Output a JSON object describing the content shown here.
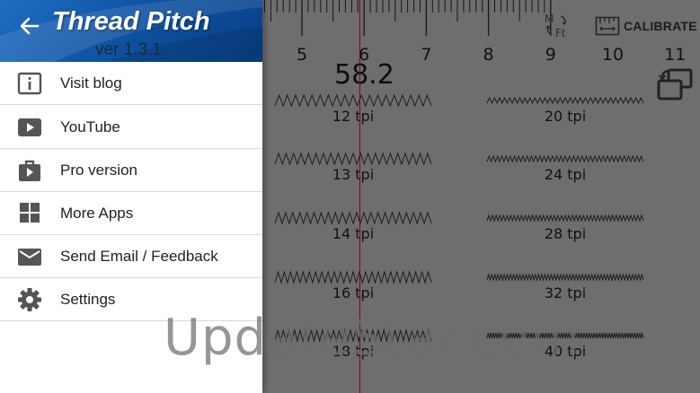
{
  "app": {
    "title": "Thread Pitch",
    "version": "ver 1.3.1"
  },
  "drawer": {
    "back_icon": "arrow-left-icon",
    "items": [
      {
        "label": "Visit blog",
        "icon": "info-icon"
      },
      {
        "label": "YouTube",
        "icon": "play-icon"
      },
      {
        "label": "Pro version",
        "icon": "shopping-bag-icon"
      },
      {
        "label": "More Apps",
        "icon": "grid-icon"
      },
      {
        "label": "Send Email / Feedback",
        "icon": "mail-icon"
      },
      {
        "label": "Settings",
        "icon": "gear-icon"
      }
    ]
  },
  "ruler": {
    "numbers": [
      "5",
      "6",
      "7",
      "8",
      "9",
      "10",
      "11"
    ],
    "measurement": "58.2",
    "units_icon": "metric-imperial-toggle-icon",
    "calibrate_label": "CALIBRATE",
    "rotate_icon": "rotate-screen-icon"
  },
  "threads": {
    "left": [
      "12 tpi",
      "13 tpi",
      "14 tpi",
      "16 tpi",
      "18 tpi"
    ],
    "right": [
      "20 tpi",
      "24 tpi",
      "28 tpi",
      "32 tpi",
      "40 tpi"
    ]
  },
  "watermark": "UpdateStar.com",
  "colors": {
    "header_blue": "#1565c0",
    "measure_line": "#c41c1c",
    "icon_gray": "#555555"
  }
}
